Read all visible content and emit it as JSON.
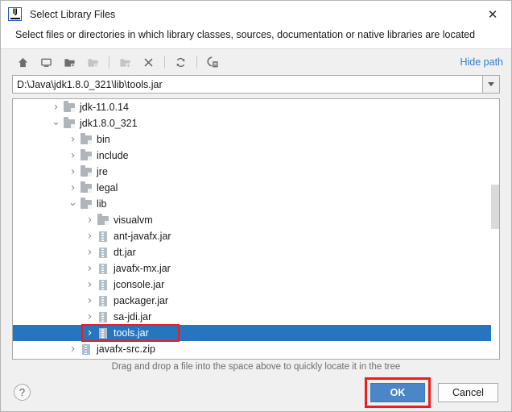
{
  "window": {
    "title": "Select Library Files",
    "app_icon": "intellij-idea-icon",
    "close_label": "✕"
  },
  "subtitle": "Select files or directories in which library classes, sources, documentation or native libraries are located",
  "toolbar": {
    "buttons": [
      {
        "name": "home-icon",
        "tooltip": "Home",
        "enabled": true
      },
      {
        "name": "desktop-icon",
        "tooltip": "Desktop",
        "enabled": true
      },
      {
        "name": "project-folder-icon",
        "tooltip": "Project Directory",
        "enabled": true
      },
      {
        "name": "module-folder-icon",
        "tooltip": "Module Directory",
        "enabled": false
      },
      {
        "name": "new-folder-icon",
        "tooltip": "New Folder",
        "enabled": false
      },
      {
        "name": "delete-icon",
        "tooltip": "Delete",
        "enabled": true
      },
      {
        "name": "refresh-icon",
        "tooltip": "Refresh",
        "enabled": true
      },
      {
        "name": "show-hidden-files-icon",
        "tooltip": "Show Hidden Files",
        "enabled": true
      }
    ],
    "hide_path_label": "Hide path"
  },
  "path_field": {
    "value": "D:\\Java\\jdk1.8.0_321\\lib\\tools.jar",
    "placeholder": "",
    "dropdown_icon": "chevron-down-icon"
  },
  "tree": {
    "rows": [
      {
        "label": "jdk-11.0.14",
        "indent": 2,
        "twisty": "collapsed",
        "icon": "folder"
      },
      {
        "label": "jdk1.8.0_321",
        "indent": 2,
        "twisty": "expanded",
        "icon": "folder"
      },
      {
        "label": "bin",
        "indent": 3,
        "twisty": "collapsed",
        "icon": "folder"
      },
      {
        "label": "include",
        "indent": 3,
        "twisty": "collapsed",
        "icon": "folder"
      },
      {
        "label": "jre",
        "indent": 3,
        "twisty": "collapsed",
        "icon": "folder"
      },
      {
        "label": "legal",
        "indent": 3,
        "twisty": "collapsed",
        "icon": "folder"
      },
      {
        "label": "lib",
        "indent": 3,
        "twisty": "expanded",
        "icon": "folder"
      },
      {
        "label": "visualvm",
        "indent": 4,
        "twisty": "collapsed",
        "icon": "folder"
      },
      {
        "label": "ant-javafx.jar",
        "indent": 4,
        "twisty": "collapsed",
        "icon": "jar"
      },
      {
        "label": "dt.jar",
        "indent": 4,
        "twisty": "collapsed",
        "icon": "jar"
      },
      {
        "label": "javafx-mx.jar",
        "indent": 4,
        "twisty": "collapsed",
        "icon": "jar"
      },
      {
        "label": "jconsole.jar",
        "indent": 4,
        "twisty": "collapsed",
        "icon": "jar"
      },
      {
        "label": "packager.jar",
        "indent": 4,
        "twisty": "collapsed",
        "icon": "jar"
      },
      {
        "label": "sa-jdi.jar",
        "indent": 4,
        "twisty": "collapsed",
        "icon": "jar"
      },
      {
        "label": "tools.jar",
        "indent": 4,
        "twisty": "collapsed",
        "icon": "jar",
        "selected": true,
        "annotated": true
      },
      {
        "label": "javafx-src.zip",
        "indent": 3,
        "twisty": "collapsed",
        "icon": "zip"
      }
    ],
    "twisty_glyphs": {
      "collapsed": "›",
      "expanded": "⌄"
    },
    "selection_color": "#2675bf",
    "annotation_color": "#ee1c1c",
    "scrollbar": {
      "thumb_top_pct": 33,
      "thumb_height_pct": 17
    }
  },
  "hint": "Drag and drop a file into the space above to quickly locate it in the tree",
  "footer": {
    "help_label": "?",
    "ok_label": "OK",
    "cancel_label": "Cancel",
    "ok_annotated": true
  }
}
